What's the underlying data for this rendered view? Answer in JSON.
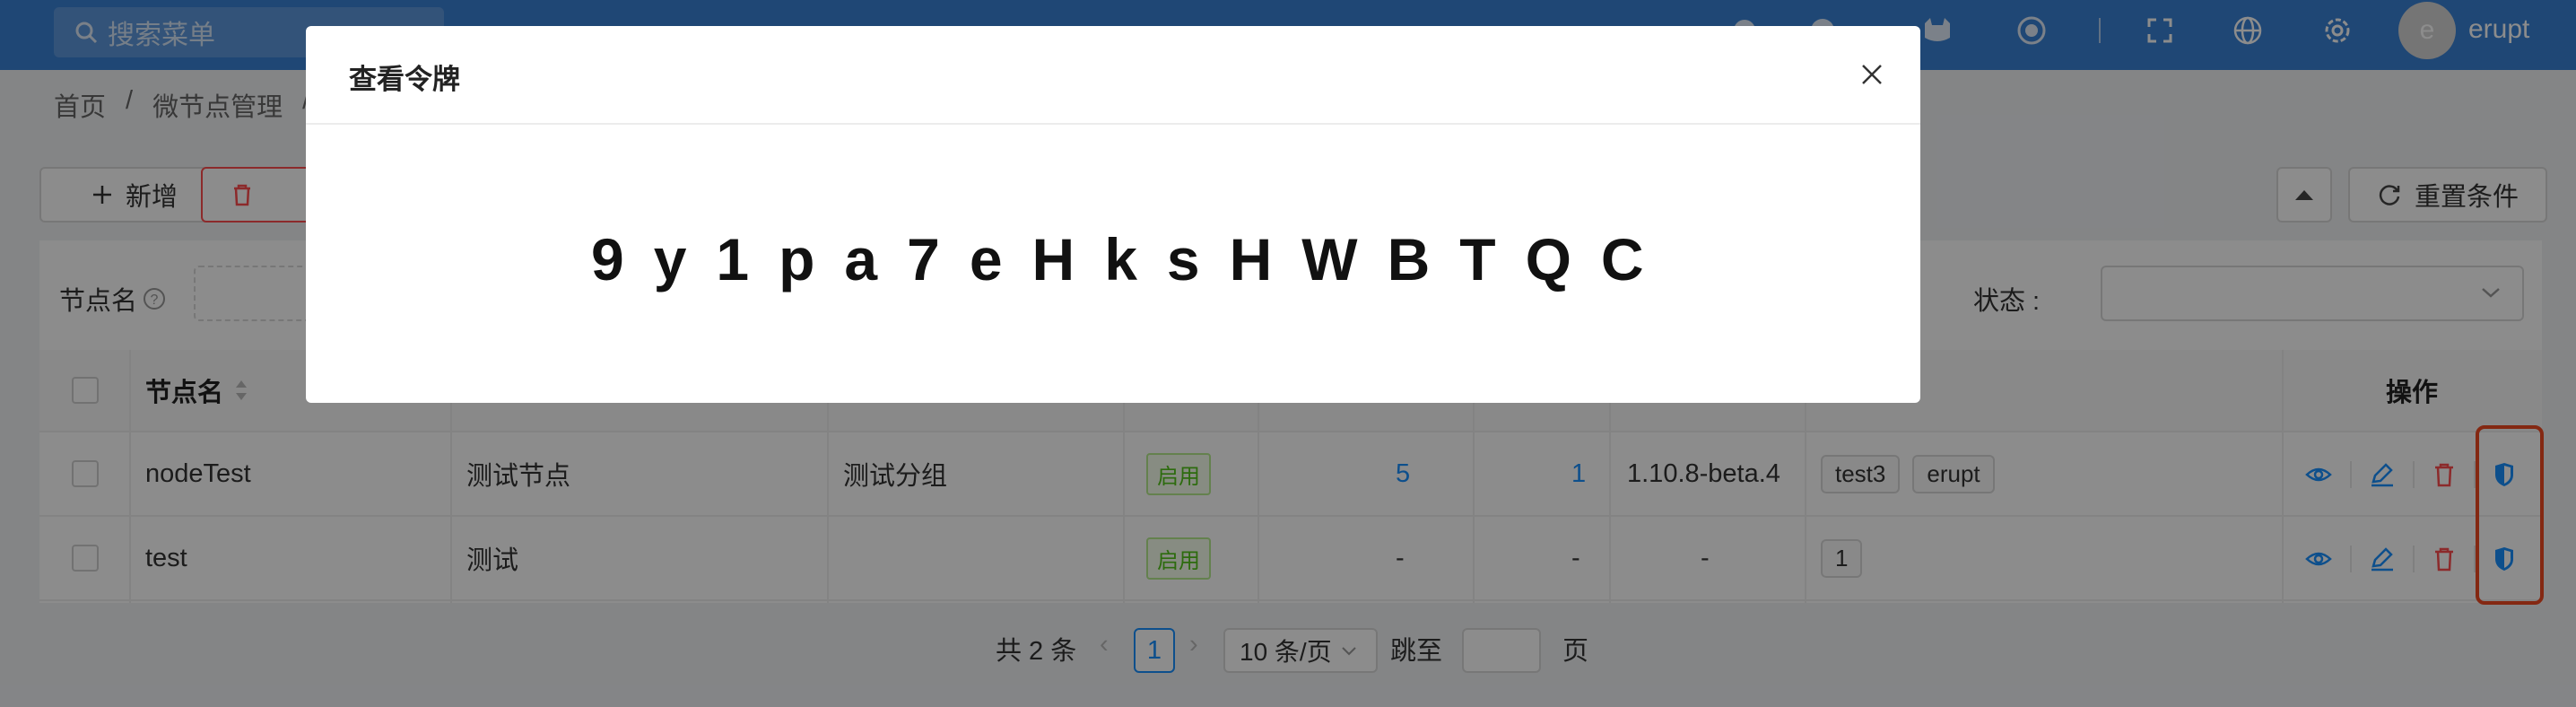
{
  "header": {
    "search_placeholder": "搜索菜单",
    "user": "erupt",
    "avatar_letter": "e",
    "icons": [
      "search-icon",
      "github-icon",
      "record-icon",
      "fullscreen-icon",
      "globe-icon",
      "gear-icon"
    ]
  },
  "breadcrumb": [
    "首页",
    "/",
    "微节点管理",
    "/"
  ],
  "toolbar": {
    "add_label": "新增",
    "delete_label": "删除",
    "reset_label": "重置条件"
  },
  "filter": {
    "node_name_label": "节点名",
    "status_label": "状态 :"
  },
  "table": {
    "headers": {
      "node_name": "节点名",
      "ops": "操作"
    },
    "rows": [
      {
        "name": "nodeTest",
        "display": "测试节点",
        "group": "测试分组",
        "status": "启用",
        "count1": "5",
        "count2": "1",
        "version": "1.10.8-beta.4",
        "tags": [
          "test3",
          "erupt"
        ]
      },
      {
        "name": "test",
        "display": "测试",
        "group": "",
        "status": "启用",
        "count1": "-",
        "count2": "-",
        "version": "-",
        "tags": [
          "1"
        ]
      }
    ]
  },
  "pagination": {
    "total": "共 2 条",
    "current": "1",
    "page_size": "10 条/页",
    "jump_label": "跳至",
    "page_suffix": "页"
  },
  "modal": {
    "title": "查看令牌",
    "token": "9y1pa7eHksHWBTQC"
  },
  "colors": {
    "header_bg": "#3a82d6",
    "danger": "#ff4d4f",
    "primary": "#1890ff",
    "success": "#52c41a",
    "highlight": "#f04a22"
  }
}
